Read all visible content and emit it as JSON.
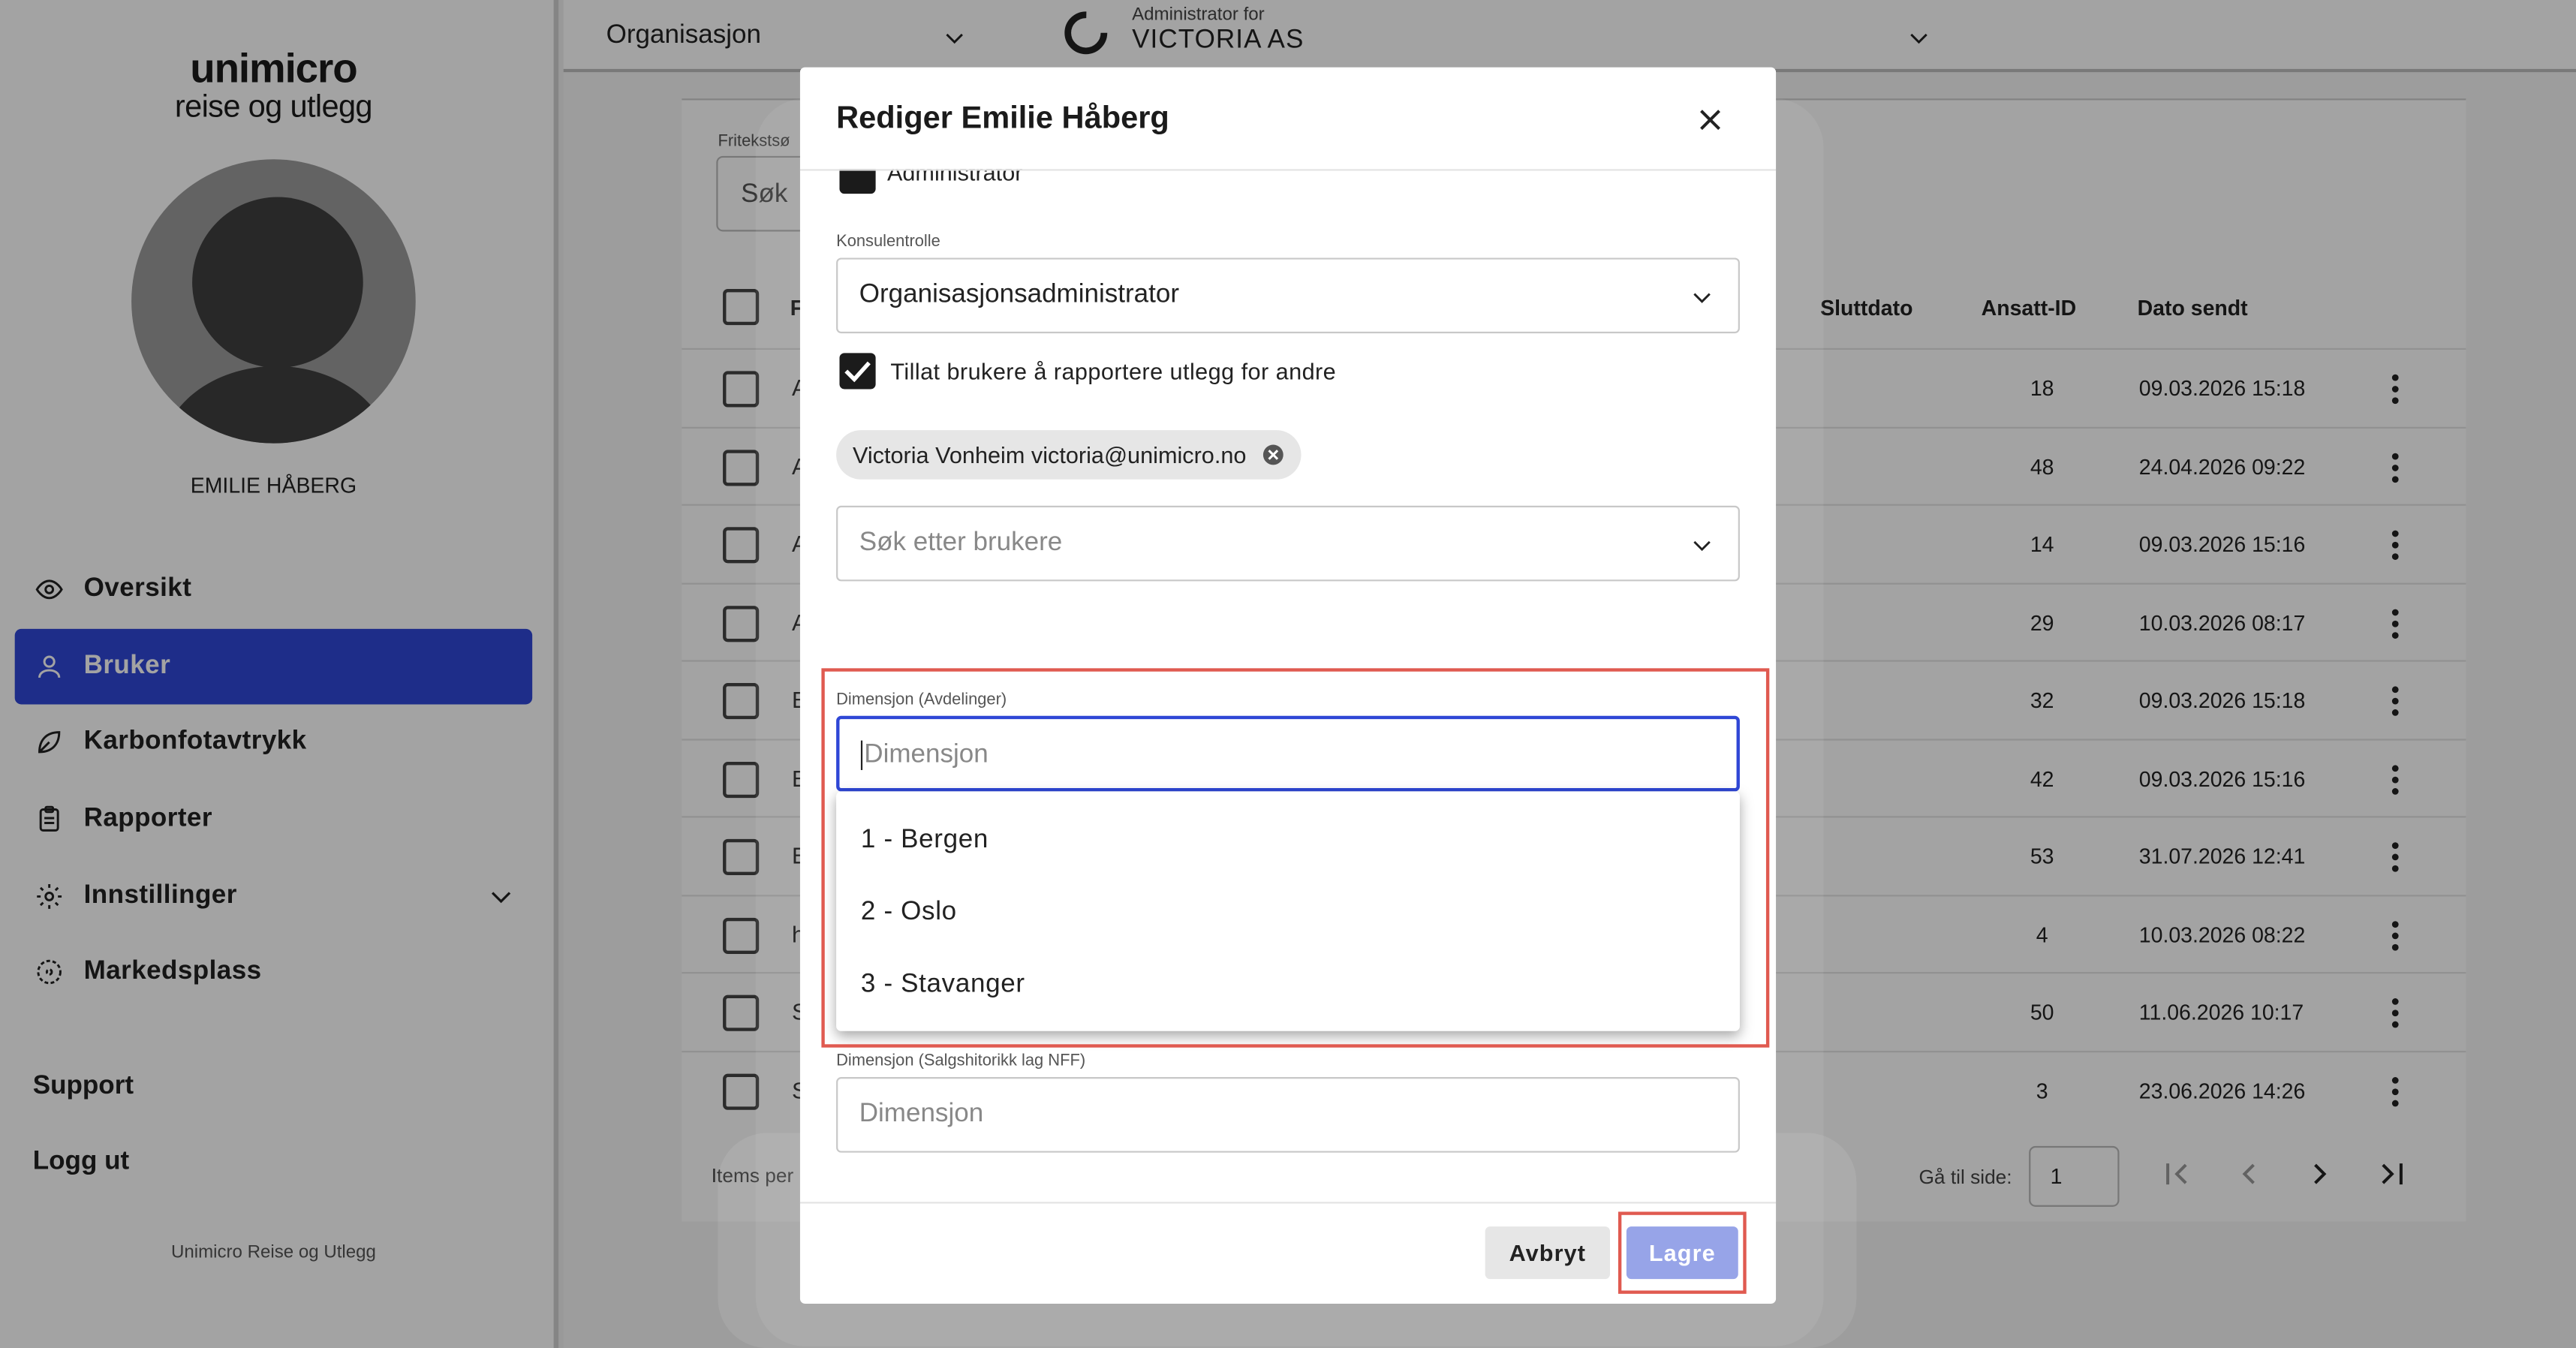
{
  "sidebar": {
    "logo_line1": "unimicro",
    "logo_line2": "reise og utlegg",
    "user_name": "EMILIE HÅBERG",
    "nav": [
      {
        "label": "Oversikt"
      },
      {
        "label": "Bruker"
      },
      {
        "label": "Karbonfotavtrykk"
      },
      {
        "label": "Rapporter"
      },
      {
        "label": "Innstillinger"
      },
      {
        "label": "Markedsplass"
      }
    ],
    "support": "Support",
    "logout": "Logg ut",
    "footer": "Unimicro Reise og Utlegg"
  },
  "topbar": {
    "org_select": "Organisasjon",
    "admin_for": "Administrator for",
    "admin_org": "VICTORIA AS"
  },
  "list": {
    "search_label": "Fritekstsø",
    "search_placeholder": "Søk",
    "columns": {
      "end_date": "Sluttdato",
      "employee_id": "Ansatt-ID",
      "date_sent": "Dato sendt",
      "first": "F"
    },
    "rows": [
      {
        "init": "A",
        "aid": "18",
        "date": "09.03.2026 15:18"
      },
      {
        "init": "A",
        "aid": "48",
        "date": "24.04.2026 09:22"
      },
      {
        "init": "A",
        "aid": "14",
        "date": "09.03.2026 15:16"
      },
      {
        "init": "A",
        "aid": "29",
        "date": "10.03.2026 08:17"
      },
      {
        "init": "E",
        "aid": "32",
        "date": "09.03.2026 15:18"
      },
      {
        "init": "E",
        "aid": "42",
        "date": "09.03.2026 15:16"
      },
      {
        "init": "E",
        "aid": "53",
        "date": "31.07.2026 12:41"
      },
      {
        "init": "h",
        "aid": "4",
        "date": "10.03.2026 08:22"
      },
      {
        "init": "S",
        "aid": "50",
        "date": "11.06.2026 10:17"
      },
      {
        "init": "S",
        "aid": "3",
        "date": "23.06.2026 14:26"
      }
    ],
    "items_per": "Items per",
    "goto_label": "Gå til side:",
    "goto_value": "1"
  },
  "modal": {
    "title": "Rediger Emilie Håberg",
    "admin_checkbox": "Administrator",
    "consultant_label": "Konsulentrolle",
    "consultant_value": "Organisasjonsadministrator",
    "allow_report": "Tillat brukere å rapportere utlegg for andre",
    "chip": "Victoria Vonheim victoria@unimicro.no",
    "search_users_placeholder": "Søk etter brukere",
    "dim1_label": "Dimensjon (Avdelinger)",
    "dim1_placeholder": "Dimensjon",
    "dim_options": [
      "1 - Bergen",
      "2 - Oslo",
      "3 - Stavanger"
    ],
    "dim2_label": "Dimensjon (Salgshitorikk lag NFF)",
    "dim2_placeholder": "Dimensjon",
    "cancel": "Avbryt",
    "save": "Lagre"
  },
  "colors": {
    "accent": "#2f47d6",
    "save_disabled": "#97a4e8",
    "highlight": "#e05a50"
  }
}
